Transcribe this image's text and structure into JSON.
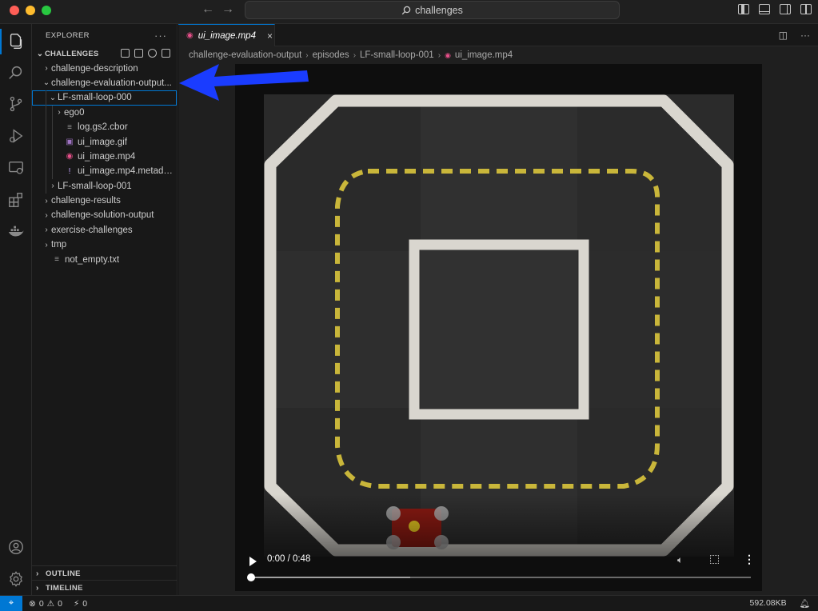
{
  "titlebar": {
    "search_text": "challenges"
  },
  "explorer": {
    "header": "EXPLORER",
    "more": "···",
    "root_label": "CHALLENGES",
    "items": [
      {
        "label": "challenge-description",
        "indent": 0,
        "chevron": "›",
        "icon": ""
      },
      {
        "label": "challenge-evaluation-output...",
        "indent": 0,
        "chevron": "⌄",
        "icon": ""
      },
      {
        "label": "LF-small-loop-000",
        "indent": 1,
        "chevron": "⌄",
        "icon": ""
      },
      {
        "label": "ego0",
        "indent": 2,
        "chevron": "›",
        "icon": ""
      },
      {
        "label": "log.gs2.cbor",
        "indent": 2,
        "chevron": "",
        "icon": "≡"
      },
      {
        "label": "ui_image.gif",
        "indent": 2,
        "chevron": "",
        "icon": "▣"
      },
      {
        "label": "ui_image.mp4",
        "indent": 2,
        "chevron": "",
        "icon": "◉"
      },
      {
        "label": "ui_image.mp4.metadata.y...",
        "indent": 2,
        "chevron": "",
        "icon": "!"
      },
      {
        "label": "LF-small-loop-001",
        "indent": 1,
        "chevron": "›",
        "icon": ""
      },
      {
        "label": "challenge-results",
        "indent": 0,
        "chevron": "›",
        "icon": ""
      },
      {
        "label": "challenge-solution-output",
        "indent": 0,
        "chevron": "›",
        "icon": ""
      },
      {
        "label": "exercise-challenges",
        "indent": 0,
        "chevron": "›",
        "icon": ""
      },
      {
        "label": "tmp",
        "indent": 0,
        "chevron": "›",
        "icon": ""
      },
      {
        "label": "not_empty.txt",
        "indent": 0,
        "chevron": "",
        "icon": "≡"
      }
    ],
    "outline_label": "OUTLINE",
    "timeline_label": "TIMELINE"
  },
  "editor": {
    "tab_label": "ui_image.mp4",
    "tab_close": "×",
    "breadcrumb": [
      "challenge-evaluation-output",
      "episodes",
      "LF-small-loop-001",
      "ui_image.mp4"
    ]
  },
  "video": {
    "time": "0:00 / 0:48",
    "progress": 0,
    "buffered": 0.32
  },
  "statusbar": {
    "remote": "⌖",
    "errors": "0",
    "warnings": "0",
    "ports": "0",
    "file_size": "592.08KB"
  },
  "colors": {
    "accent": "#0078d4",
    "annotation_arrow": "#1a3cff",
    "tape_white": "#d9d6cf",
    "tape_yellow": "#c9b63a",
    "tile": "#2f2f2f",
    "bot_red": "#8b1a12"
  }
}
